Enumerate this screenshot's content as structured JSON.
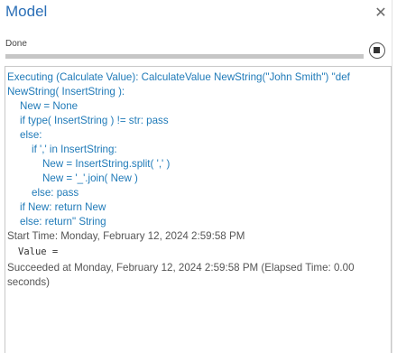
{
  "window": {
    "title": "Model",
    "close_glyph": "✕"
  },
  "progress": {
    "status": "Done",
    "value": 1.0
  },
  "output": {
    "lines": [
      "Executing (Calculate Value): CalculateValue NewString(\"John Smith\") \"def",
      "NewString( InsertString ):",
      "New = None",
      "if type( InsertString ) != str: pass",
      "else:",
      "if ',' in InsertString:",
      "New = InsertString.split( ',' )",
      "New = '_'.join( New )",
      "else: pass",
      "if New: return New",
      "else: return\" String",
      "Start Time: Monday, February 12, 2024 2:59:58 PM",
      "Value =",
      "Succeeded at Monday, February 12, 2024 2:59:58 PM (Elapsed Time: 0.00",
      "seconds)"
    ]
  },
  "colors": {
    "title": "#2b6fb7",
    "code_text": "#1f7ab8",
    "message_text": "#555555"
  },
  "icons": {
    "close": "close-icon",
    "stop": "stop-icon"
  }
}
